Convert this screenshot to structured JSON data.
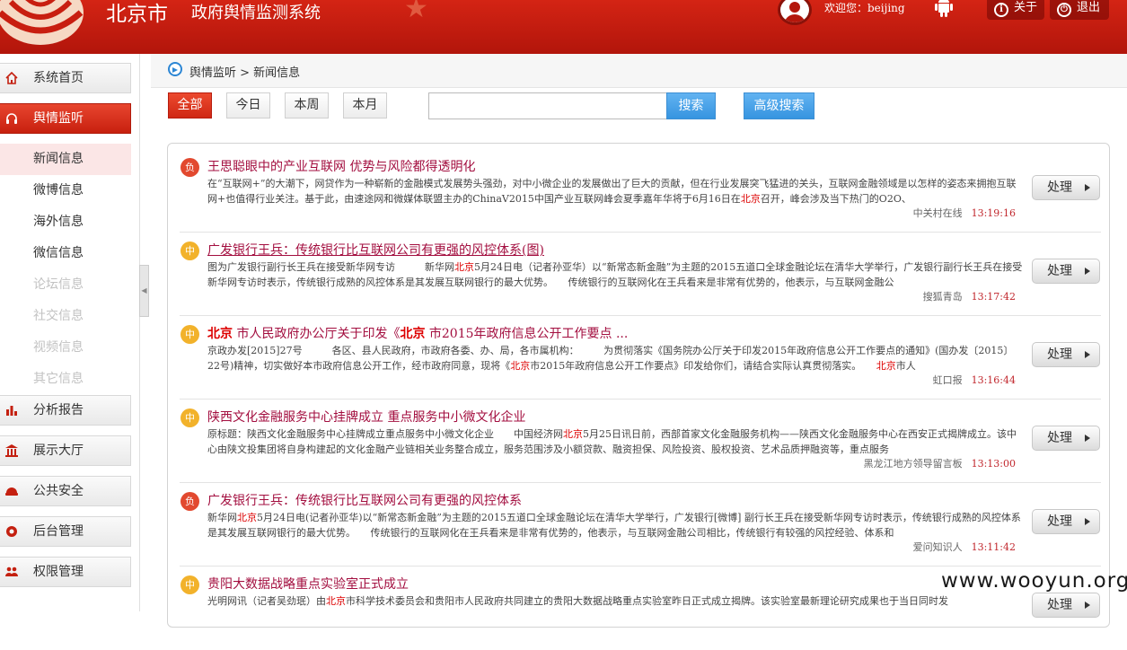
{
  "header": {
    "city": "北京市",
    "system_name": "政府舆情监测系统",
    "welcome": "欢迎您：beijing",
    "about_label": "关于",
    "logout_label": "退出"
  },
  "sidebar": {
    "items": [
      {
        "label": "系统首页",
        "icon": "home-icon"
      },
      {
        "label": "舆情监听",
        "icon": "headphones-icon",
        "active": true
      },
      {
        "label": "分析报告",
        "icon": "bar-chart-icon"
      },
      {
        "label": "展示大厅",
        "icon": "building-icon"
      },
      {
        "label": "公共安全",
        "icon": "helmet-icon"
      },
      {
        "label": "后台管理",
        "icon": "settings-icon"
      },
      {
        "label": "权限管理",
        "icon": "users-icon"
      }
    ],
    "sub_items": [
      {
        "label": "新闻信息",
        "selected": true
      },
      {
        "label": "微博信息"
      },
      {
        "label": "海外信息"
      },
      {
        "label": "微信信息"
      },
      {
        "label": "论坛信息",
        "disabled": true
      },
      {
        "label": "社交信息",
        "disabled": true
      },
      {
        "label": "视频信息",
        "disabled": true
      },
      {
        "label": "其它信息",
        "disabled": true
      }
    ]
  },
  "breadcrumb": "舆情监听 > 新闻信息",
  "filters": [
    "全部",
    "今日",
    "本周",
    "本月"
  ],
  "search": {
    "value": "",
    "button": "搜索",
    "advanced": "高级搜索"
  },
  "news": [
    {
      "sentiment": "负",
      "title": "王思聪眼中的产业互联网 优势与风险都得透明化",
      "desc": "在“互联网+”的大潮下，网贷作为一种崭新的金融模式发展势头强劲，对中小微企业的发展做出了巨大的贡献，但在行业发展突飞猛进的关头，互联网金融领域是以怎样的姿态来拥抱互联网+也值得行业关注。基于此，由速途网和微媒体联盟主办的ChinaV2015中国产业互联网峰会夏季嘉年华将于6月16日在北京召开，峰会涉及当下热门的O2O、",
      "source": "中关村在线",
      "time": "13:19:16"
    },
    {
      "sentiment": "中",
      "title": "广发银行王兵：传统银行比互联网公司有更强的风控体系(图)",
      "desc": "图为广发银行副行长王兵在接受新华网专访　　　新华网北京5月24日电（记者孙亚华）以“新常态新金融”为主题的2015五道口全球金融论坛在清华大学举行，广发银行副行长王兵在接受新华网专访时表示，传统银行成熟的风控体系是其发展互联网银行的最大优势。　　传统银行的互联网化在王兵看来是非常有优势的，他表示，与互联网金融公",
      "source": "搜狐青岛",
      "time": "13:17:42"
    },
    {
      "sentiment": "中",
      "title_prefix": "北京",
      "title_mid": " 市人民政府办公厅关于印发《",
      "title_mid2": "北京",
      "title_suffix": " 市2015年政府信息公开工作要点 ...",
      "desc": "京政办发[2015]27号　　　各区、县人民政府，市政府各委、办、局，各市属机构：　　　为贯彻落实《国务院办公厅关于印发2015年政府信息公开工作要点的通知》(国办发〔2015〕22号)精神，切实做好本市政府信息公开工作，经市政府同意，现将《北京市2015年政府信息公开工作要点》印发给你们，请结合实际认真贯彻落实。　　北京市人",
      "source": "虹口报",
      "time": "13:16:44"
    },
    {
      "sentiment": "中",
      "title": "陕西文化金融服务中心挂牌成立 重点服务中小微文化企业",
      "desc": "原标题：陕西文化金融服务中心挂牌成立重点服务中小微文化企业　　中国经济网北京5月25日讯日前，西部首家文化金融服务机构——陕西文化金融服务中心在西安正式揭牌成立。该中心由陕文投集团将自身构建起的文化金融产业链相关业务整合成立，服务范围涉及小额贷款、融资担保、风险投资、股权投资、艺术品质押融资等，重点服务",
      "source": "黑龙江地方领导留言板",
      "time": "13:13:00"
    },
    {
      "sentiment": "负",
      "title": "广发银行王兵：传统银行比互联网公司有更强的风控体系",
      "desc": "新华网北京5月24日电(记者孙亚华)以“新常态新金融”为主题的2015五道口全球金融论坛在清华大学举行，广发银行[微博] 副行长王兵在接受新华网专访时表示，传统银行成熟的风控体系是其发展互联网银行的最大优势。　　传统银行的互联网化在王兵看来是非常有优势的，他表示，与互联网金融公司相比，传统银行有较强的风控经验、体系和",
      "source": "爱问知识人",
      "time": "13:11:42"
    },
    {
      "sentiment": "中",
      "title": "贵阳大数据战略重点实验室正式成立",
      "desc": "光明网讯（记者吴劲珉）由北京市科学技术委员会和贵阳市人民政府共同建立的贵阳大数据战略重点实验室昨日正式成立揭牌。该实验室最新理论研究成果也于当日同时发",
      "source": "",
      "time": ""
    }
  ],
  "action_label": "处理",
  "watermark": "www.wooyun.org",
  "highlight_word": "北京"
}
